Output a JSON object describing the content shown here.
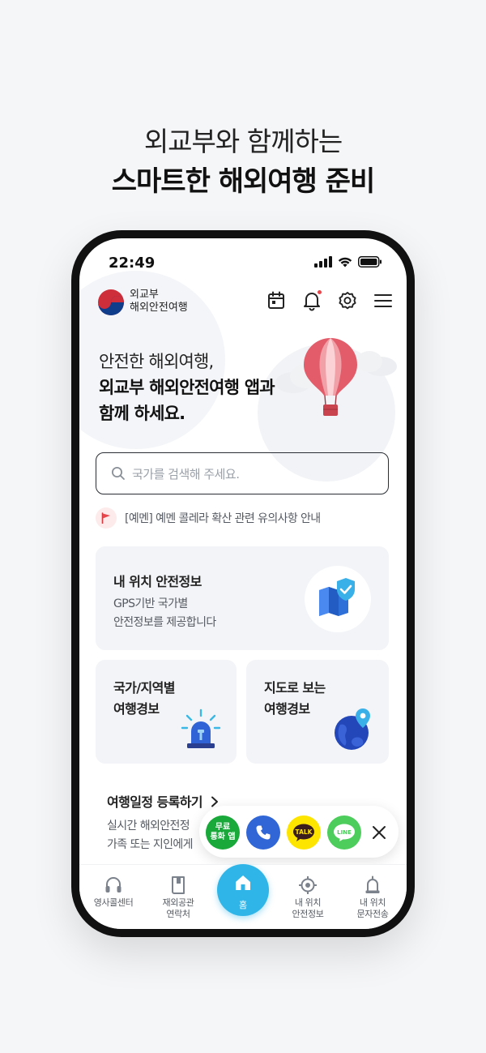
{
  "promo": {
    "line1": "외교부와 함께하는",
    "line2": "스마트한 해외여행 준비"
  },
  "status_bar": {
    "time": "22:49"
  },
  "app_header": {
    "logo_line1": "외교부",
    "logo_line2": "해외안전여행",
    "icons": [
      "calendar-icon",
      "bell-icon",
      "settings-icon",
      "menu-icon"
    ]
  },
  "hero": {
    "line1": "안전한 해외여행,",
    "line2": "외교부 해외안전여행 앱과",
    "line3": "함께 하세요."
  },
  "search": {
    "placeholder": "국가를 검색해 주세요."
  },
  "notice": {
    "text": "[예멘] 예멘 콜레라 확산 관련 유의사항 안내"
  },
  "cards": {
    "my_location": {
      "title": "내 위치 안전정보",
      "desc1": "GPS기반 국가별",
      "desc2": "안전정보를 제공합니다"
    },
    "country_alert": {
      "line1": "국가/지역별",
      "line2": "여행경보"
    },
    "map_alert": {
      "line1": "지도로 보는",
      "line2": "여행경보"
    }
  },
  "schedule": {
    "title": "여행일정 등록하기",
    "desc1": "실시간 해외안전정",
    "desc2": "가족 또는 지인에게"
  },
  "floating_bar": {
    "free_call_line1": "무료",
    "free_call_line2": "통화 앱",
    "kakao_label": "TALK",
    "line_label": "LINE"
  },
  "bottom_nav": {
    "consulate_call": "영사콜센터",
    "embassy_line1": "재외공관",
    "embassy_line2": "연락처",
    "home": "홈",
    "my_loc_line1": "내 위치",
    "my_loc_line2": "안전정보",
    "my_sms_line1": "내 위치",
    "my_sms_line2": "문자전송"
  },
  "colors": {
    "accent": "#2fb5e8",
    "free_call": "#19a83a",
    "call": "#3066d6",
    "kakao": "#fee500",
    "line": "#4ccd5c",
    "notice_flag": "#e5484d"
  }
}
